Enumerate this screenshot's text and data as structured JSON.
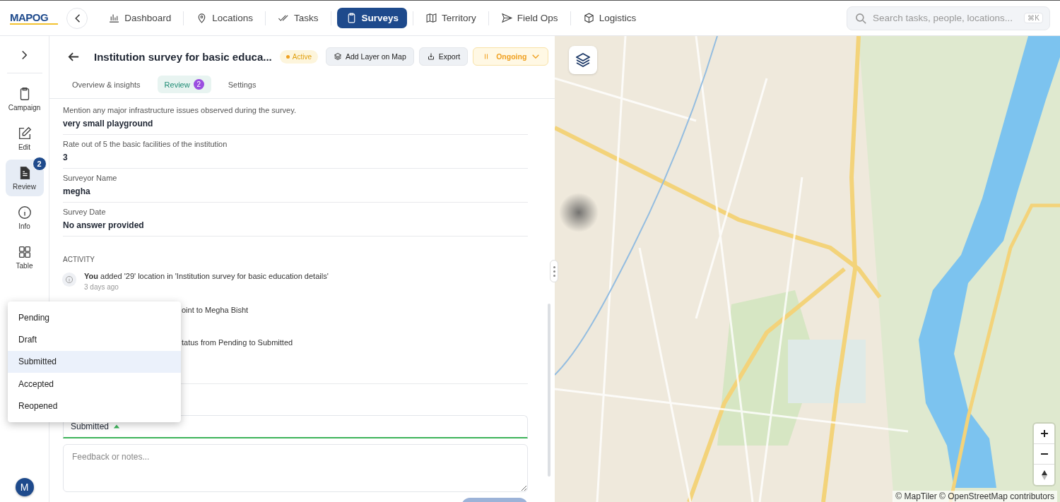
{
  "nav": {
    "logo": "MAPOG",
    "items": [
      {
        "label": "Dashboard",
        "selected": false
      },
      {
        "label": "Locations",
        "selected": false
      },
      {
        "label": "Tasks",
        "selected": false
      },
      {
        "label": "Surveys",
        "selected": true
      },
      {
        "label": "Territory",
        "selected": false
      },
      {
        "label": "Field Ops",
        "selected": false
      },
      {
        "label": "Logistics",
        "selected": false
      }
    ],
    "search": {
      "placeholder": "Search tasks, people, locations...",
      "shortcut": "⌘K"
    }
  },
  "rail": {
    "items": [
      {
        "label": "Campaign",
        "selected": false
      },
      {
        "label": "Edit",
        "selected": false
      },
      {
        "label": "Review",
        "selected": true,
        "badge": "2"
      },
      {
        "label": "Info",
        "selected": false
      },
      {
        "label": "Table",
        "selected": false
      }
    ],
    "avatar": "M"
  },
  "survey": {
    "title": "Institution survey for basic educa...",
    "status": "Active",
    "actions": [
      {
        "label": "Add Layer on Map"
      },
      {
        "label": "Export"
      }
    ],
    "phase": "Ongoing"
  },
  "tabs": [
    {
      "label": "Overview & insights",
      "selected": false
    },
    {
      "label": "Review",
      "selected": true,
      "badge": "2"
    },
    {
      "label": "Settings",
      "selected": false
    }
  ],
  "answers": [
    {
      "question": "Mention any major infrastructure issues observed during the survey.",
      "answer": "very small playground"
    },
    {
      "question": "Rate out of 5 the basic facilities of the institution",
      "answer": "3"
    },
    {
      "question": "Surveyor Name",
      "answer": "megha"
    },
    {
      "question": "Survey Date",
      "answer": "No answer provided"
    }
  ],
  "activity": {
    "heading": "ACTIVITY",
    "items": [
      {
        "kind": "full",
        "text": "**You** added '29' location in 'Institution survey for basic education details'",
        "time": "3 days ago"
      },
      {
        "kind": "partial",
        "text": "oint to Megha Bisht"
      },
      {
        "kind": "partial",
        "text": "tatus from Pending to Submitted"
      }
    ]
  },
  "review": {
    "value": "Submitted",
    "expanded": true,
    "placeholder": "Feedback or notes..."
  },
  "status_menu": [
    {
      "label": "Pending",
      "selected": false
    },
    {
      "label": "Draft",
      "selected": false
    },
    {
      "label": "Submitted",
      "selected": true
    },
    {
      "label": "Accepted",
      "selected": false
    },
    {
      "label": "Reopened",
      "selected": false
    }
  ],
  "map": {
    "attribution": "© MapTiler © OpenStreetMap contributors"
  }
}
